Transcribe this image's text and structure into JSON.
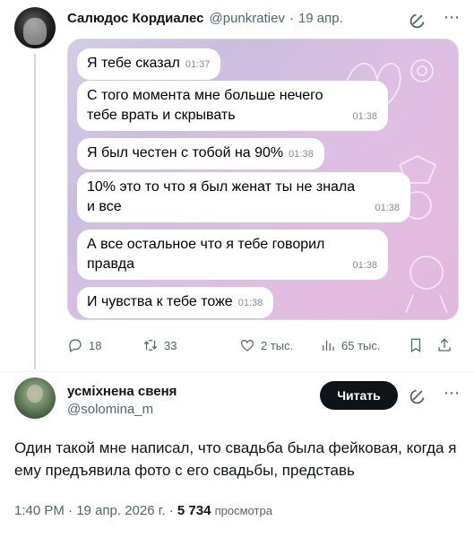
{
  "tweet": {
    "author_name": "Салюдос Кордиалес",
    "author_handle": "@punkratiev",
    "separator": "·",
    "date": "19 апр.",
    "messages": [
      {
        "text": "Я тебе сказал",
        "time": "01:37"
      },
      {
        "text": "С того момента мне больше нечего\nтебе врать и скрывать",
        "time": "01:38"
      },
      {
        "text": "Я был честен с тобой на 90%",
        "time": "01:38"
      },
      {
        "text": "10% это то что я был женат ты не знала\nи все",
        "time": "01:38"
      },
      {
        "text": "А все остальное что я тебе говорил\nправда",
        "time": "01:38"
      },
      {
        "text": "И чувства к тебе тоже",
        "time": "01:38"
      }
    ],
    "actions": {
      "replies": "18",
      "reposts": "33",
      "likes": "2 тыс.",
      "views": "65 тыс."
    }
  },
  "reply": {
    "author_name": "усміхнена свеня",
    "author_handle": "@solomina_m",
    "follow_label": "Читать",
    "text": "Один такой мне написал, что свадьба была фейковая, когда я ему предъявила фото с его свадьбы, представь",
    "time": "1:40 PM",
    "date": "19 апр. 2026 г.",
    "separator": "·",
    "views_count": "5 734",
    "views_label": "просмотра"
  },
  "colors": {
    "text_primary": "#0f1419",
    "text_secondary": "#536471",
    "follow_button_bg": "#0f1419",
    "chat_background": "#d9c3e3"
  },
  "icons": {
    "reply": "reply-icon",
    "repost": "repost-icon",
    "like": "heart-icon",
    "views": "views-icon",
    "bookmark": "bookmark-icon",
    "share": "share-icon",
    "grok": "grok-icon",
    "more": "more-icon"
  }
}
